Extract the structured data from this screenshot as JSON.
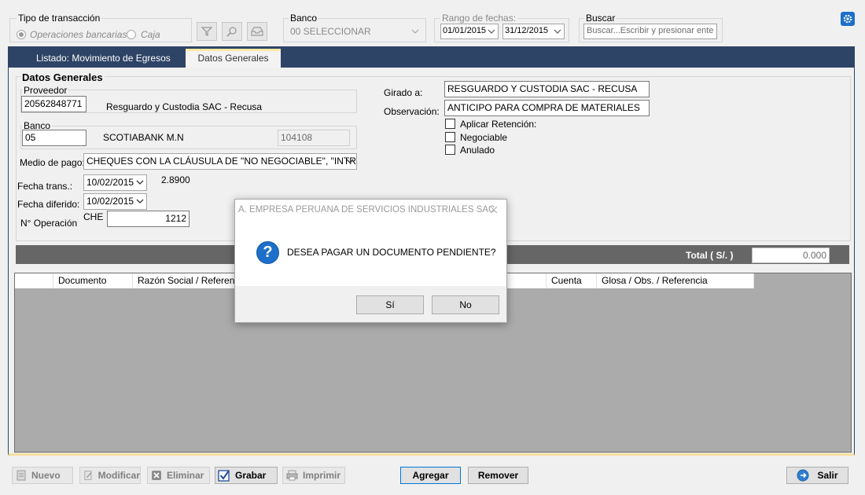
{
  "filters": {
    "tipo_legend": "Tipo de transacción",
    "opt_bancarias": "Operaciones bancarias",
    "opt_caja": "Caja",
    "banco_legend": "Banco",
    "banco_value": "00 SELECCIONAR",
    "rango_legend": "Rango de fechas:",
    "fecha_desde": "01/01/2015",
    "fecha_hasta": "31/12/2015",
    "buscar_legend": "Buscar",
    "buscar_placeholder": "Buscar...Escribir y presionar ente"
  },
  "tabs": {
    "listado": "Listado: Movimiento de Egresos",
    "datos": "Datos Generales"
  },
  "form": {
    "section_title": "Datos Generales",
    "proveedor_legend": "Proveedor",
    "proveedor_code": "20562848771",
    "proveedor_name": "Resguardo y Custodia SAC - Recusa",
    "banco_legend": "Banco",
    "banco_code": "05",
    "banco_name": "SCOTIABANK M.N",
    "cuenta": "104108",
    "medio_label": "Medio de pago:",
    "medio_value": "CHEQUES CON LA CLÁUSULA DE \"NO NEGOCIABLE\", \"INTRAN",
    "fecha_trans_label": "Fecha trans.:",
    "fecha_trans": "10/02/2015",
    "tipo_cambio": "2.8900",
    "fecha_dif_label": "Fecha diferido:",
    "fecha_dif": "10/02/2015",
    "operacion_label": "N° Operación",
    "operacion_prefix": "CHE",
    "operacion_value": "1212",
    "girado_label": "Girado a:",
    "girado_value": "RESGUARDO Y CUSTODIA SAC - RECUSA",
    "obs_label": "Observación:",
    "obs_value": "ANTICIPO PARA COMPRA DE MATERIALES",
    "chk_retencion": "Aplicar Retención:",
    "chk_negociable": "Negociable",
    "chk_anulado": "Anulado",
    "total_label": "Total ( S/. )",
    "total_value": "0.000"
  },
  "grid": {
    "columns": [
      "Documento",
      "Razón Social / Referencia",
      "Cuenta",
      "Glosa / Obs. / Referencia"
    ]
  },
  "dialog": {
    "title": "A. EMPRESA PERUANA DE SERVICIOS INDUSTRIALES SAC",
    "message": "DESEA PAGAR UN DOCUMENTO PENDIENTE?",
    "yes": "Sí",
    "no": "No"
  },
  "toolbar": {
    "nuevo": "Nuevo",
    "modificar": "Modificar",
    "eliminar": "Eliminar",
    "grabar": "Grabar",
    "imprimir": "Imprimir",
    "agregar": "Agregar",
    "remover": "Remover",
    "salir": "Salir"
  },
  "colors": {
    "header_navy": "#2e4466",
    "tab_accent": "#fde8a6",
    "question_blue": "#1d6fc9"
  }
}
